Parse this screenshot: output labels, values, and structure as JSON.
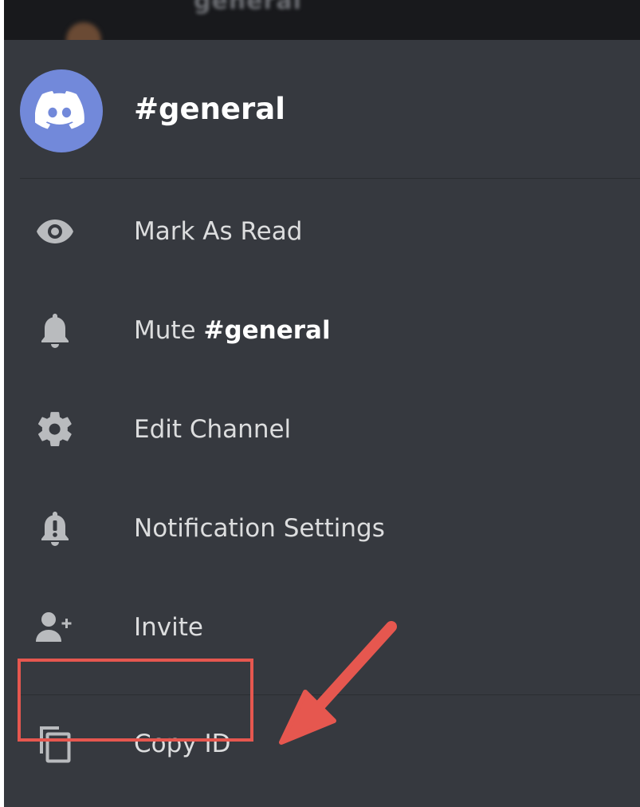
{
  "top_bar": {
    "blurred_channel_text": "general"
  },
  "header": {
    "channel_title": "#general",
    "avatar_icon": "discord-logo-icon"
  },
  "menu": {
    "items": [
      {
        "label": "Mark As Read",
        "icon": "eye-icon"
      },
      {
        "label_prefix": "Mute ",
        "label_bold": "#general",
        "icon": "bell-icon"
      },
      {
        "label": "Edit Channel",
        "icon": "gear-icon"
      },
      {
        "label": "Notification Settings",
        "icon": "bell-alert-icon"
      },
      {
        "label": "Invite",
        "icon": "add-user-icon"
      },
      {
        "label": "Copy ID",
        "icon": "copy-icon"
      }
    ]
  },
  "colors": {
    "background": "#36393f",
    "top_bar": "#18191c",
    "avatar": "#7289da",
    "text": "#dcddde",
    "highlight": "#e6574f"
  }
}
